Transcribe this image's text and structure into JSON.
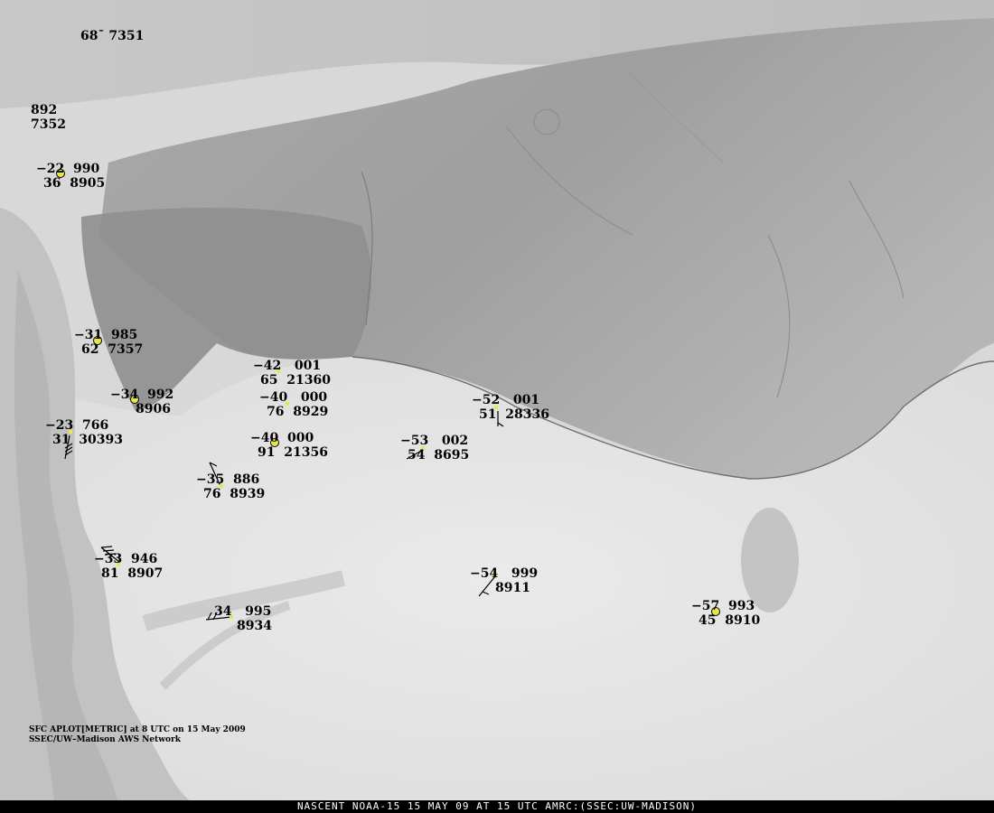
{
  "credits": {
    "line1": "SFC APLOT[METRIC] at 8 UTC on 15 May 2009",
    "line2": "SSEC/UW–Madison AWS Network"
  },
  "footer": {
    "text": "NASCENT NOAA-15 15 MAY 09 AT 15 UTC AMRC:(SSEC:UW-MADISON)"
  },
  "stations": [
    {
      "id": "7351",
      "lines": [
        "68ˉ 7351"
      ],
      "marker": "none"
    },
    {
      "id": "7352",
      "lines": [
        "892",
        "7352"
      ],
      "marker": "none"
    },
    {
      "id": "8905",
      "lines": [
        "−22  990",
        "36  8905"
      ],
      "marker": "circle"
    },
    {
      "id": "7357",
      "lines": [
        "−31  985",
        "62  7357"
      ],
      "marker": "circle"
    },
    {
      "id": "21360",
      "lines": [
        "−42   001",
        "65  21360"
      ],
      "marker": "dot"
    },
    {
      "id": "8906",
      "lines": [
        "−34  992",
        "8906"
      ],
      "marker": "circle"
    },
    {
      "id": "8929",
      "lines": [
        "−40   000",
        "76  8929"
      ],
      "marker": "dot"
    },
    {
      "id": "30393",
      "lines": [
        "−23  766",
        "31  30393"
      ],
      "marker": "dot"
    },
    {
      "id": "21356",
      "lines": [
        "−40  000",
        "91  21356"
      ],
      "marker": "circle"
    },
    {
      "id": "28336",
      "lines": [
        "−52   001",
        "51  28336"
      ],
      "marker": "dot"
    },
    {
      "id": "8695",
      "lines": [
        "−53   002",
        "54  8695"
      ],
      "marker": "dot"
    },
    {
      "id": "8939",
      "lines": [
        "−35  886",
        "76  8939"
      ],
      "marker": "dot"
    },
    {
      "id": "8907",
      "lines": [
        "−33  946",
        "81  8907"
      ],
      "marker": "dot"
    },
    {
      "id": "8911",
      "lines": [
        "−54   999",
        "8911"
      ],
      "marker": "dot"
    },
    {
      "id": "8934",
      "lines": [
        "34   995",
        "8934"
      ],
      "marker": "dot"
    },
    {
      "id": "8910",
      "lines": [
        "−57  993",
        "45  8910"
      ],
      "marker": "circle"
    }
  ]
}
